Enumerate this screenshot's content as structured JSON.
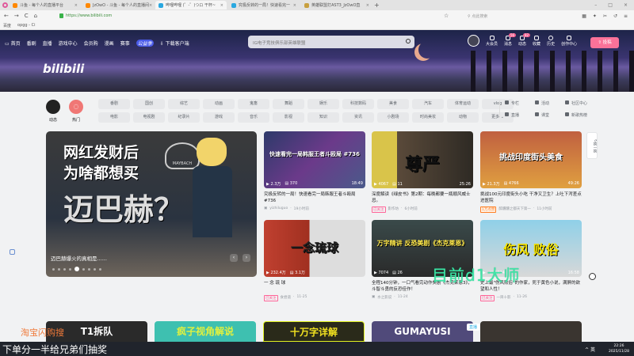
{
  "browser": {
    "tabs": [
      "斗鱼 - 每个人的直播平台",
      "JzOwO - 斗鱼 - 每个人的直播间",
      "哔哩哔哩 (゜-゜)つロ 干杯~",
      "究极反转的一局！快速看完一",
      "英雄联盟打AST3_JzOwO直"
    ],
    "url": "https://www.bilibili.com",
    "search_placeholder": "点此搜索",
    "bookmarks": [
      "百度",
      "opgg - Ci"
    ]
  },
  "nav": {
    "items": [
      "首页",
      "番剧",
      "直播",
      "游戏中心",
      "会员购",
      "漫画",
      "赛事",
      "公益季",
      "下载客户端"
    ],
    "search_placeholder": "IG电子竞技俱乐部英雄联盟",
    "user": [
      {
        "label": "大会员"
      },
      {
        "label": "消息",
        "badge": "56"
      },
      {
        "label": "动态",
        "badge": "82"
      },
      {
        "label": "收藏"
      },
      {
        "label": "历史"
      },
      {
        "label": "创作中心"
      }
    ],
    "upload": "投稿",
    "logo": "bilibili"
  },
  "channels": {
    "dynamic": "动态",
    "hot": "热门",
    "categories": [
      "番剧",
      "国创",
      "综艺",
      "动画",
      "鬼畜",
      "舞蹈",
      "娱乐",
      "科技数码",
      "美食",
      "汽车",
      "体育运动",
      "vlog",
      "电影",
      "电视剧",
      "纪录片",
      "游戏",
      "音乐",
      "影视",
      "知识",
      "资讯",
      "小剧场",
      "时尚美妆",
      "动物",
      "更多 ⌄"
    ],
    "extra": [
      "专栏",
      "活动",
      "社区中心",
      "直播",
      "课堂",
      "新歌热榜"
    ]
  },
  "carousel": {
    "lines": [
      "网红发财后",
      "为啥都想买",
      "迈巴赫？"
    ],
    "caption": "迈巴赫爆火的真相是......",
    "brand": "MAYBACH",
    "slides": 9,
    "active_slide": 5
  },
  "refresh": "换一换",
  "videos": [
    {
      "thumb_text": "快速看完一局韩服王者斗殴局 #736",
      "views": "2.3万",
      "danmaku": "370",
      "duration": "18:49",
      "title": "究极反转的一局！快速看完一局韩服王者斗殴局#736",
      "tag": "",
      "author": "yizhiluguo",
      "time": "19小时前"
    },
    {
      "thumb_text": "尊严",
      "views": "4067",
      "danmaku": "11",
      "duration": "25:26",
      "title": "深度解读《绿皮书》第2期：每晚都要一瓶顺风威士忌。",
      "tag": "已关注",
      "author": "影作坊",
      "time": "6小时前"
    },
    {
      "thumb_text": "挑战印度街头美食",
      "views": "21.3万",
      "danmaku": "4766",
      "duration": "49:26",
      "title": "挑战100元印度街头小吃 干净又卫生？上吐下泻差点进医院",
      "tag": "1万点赞",
      "author": "醉醺醺之都天下第一",
      "time": "11小时前"
    },
    {
      "thumb_text": "一念琉球",
      "views": "232.4万",
      "danmaku": "3.1万",
      "duration": "",
      "title": "一 念 琉 球",
      "tag": "已关注",
      "author": "食尝道",
      "time": "11-25"
    },
    {
      "thumb_text": "万字精讲 反恐美剧《杰克莱恩》",
      "views": "7074",
      "danmaku": "26",
      "duration": "",
      "title": "全程140分钟，一口气看完动作美剧《杰克莱恩3》，斗智斗勇的反恐佳作！",
      "tag": "",
      "author": "水之影说",
      "time": "11-24"
    },
    {
      "thumb_text": "伤风 败俗",
      "views": "",
      "danmaku": "1024",
      "duration": "16:58",
      "title": "史上最\"伤风败俗\"的作家，死于黄色小说，满屏的欲望和人性！",
      "tag": "已关注",
      "author": "一目十影",
      "time": "11-26"
    }
  ],
  "bottom_row": [
    "T1拆队",
    "疯子视角解说",
    "十万字详解",
    "GUMAYUSI",
    "直播"
  ],
  "overlays": {
    "watermark": "目前d1大师",
    "promo": "淘宝闪购搜",
    "subtitle": "下单分一半给兄弟们抽奖"
  },
  "taskbar": {
    "ime": "英",
    "time": "22:26",
    "date": "2025/11/28"
  }
}
